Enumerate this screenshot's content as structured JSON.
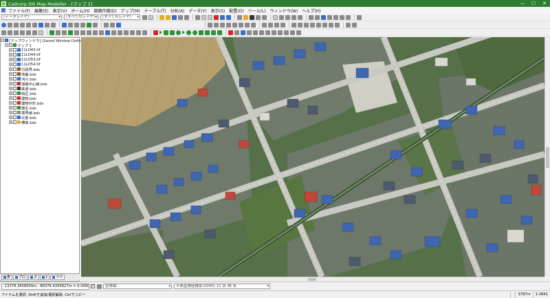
{
  "window": {
    "title": "Cadcorp SIS Map Modeller - [マップ 1]",
    "minimize_glyph": "—",
    "maximize_glyph": "☐",
    "close_glyph": "✕"
  },
  "menu": {
    "items": [
      "ファイル(F)",
      "編集(E)",
      "表示(V)",
      "ホーム(H)",
      "図面作図(D)",
      "アップ(M)",
      "テーブル(T)",
      "分析(A)",
      "データ(Y)",
      "表示(S)",
      "配置(O)",
      "ツール(L)",
      "ウィンドウ(W)",
      "ヘルプ(H)"
    ]
  },
  "toolbar1": {
    "combo_scale": "(データレイヤ)",
    "combo_layer": "(すべてのレイヤ)",
    "combo_style": "(すべてのレイヤ)"
  },
  "tree": {
    "root_label": "[マップウィンドウ] (Saved Window Definitions)",
    "map_label": "マップ 1",
    "items": [
      {
        "label": "11LD43.tif",
        "color": "#3a6fc4"
      },
      {
        "label": "11LD44.tif",
        "color": "#3a6fc4"
      },
      {
        "label": "11LD53.tif",
        "color": "#3a6fc4"
      },
      {
        "label": "11LD54.tif",
        "color": "#3a6fc4"
      },
      {
        "label": "行政界.bds",
        "color": "#8a5a2b"
      },
      {
        "label": "地番.bds",
        "color": "#8a5a2b"
      },
      {
        "label": "河川.bds",
        "color": "#3a6fc4"
      },
      {
        "label": "道路中心線.bds",
        "color": "#cc2b2b"
      },
      {
        "label": "鉄道.bds",
        "color": "#333333"
      },
      {
        "label": "街区.bds",
        "color": "#2f8f3a"
      },
      {
        "label": "建物.bds",
        "color": "#cc2b2b"
      },
      {
        "label": "建物外形.bds",
        "color": "#cc2b2b"
      },
      {
        "label": "植生.bds",
        "color": "#2f8f3a"
      },
      {
        "label": "境界線.bds",
        "color": "#8a8a8a"
      },
      {
        "label": "水部.bds",
        "color": "#3a6fc4"
      },
      {
        "label": "標高.bds",
        "color": "#e0b020"
      }
    ]
  },
  "panel_tabs": [
    "表",
    "プロ",
    "ス",
    "2",
    "ツイ"
  ],
  "coordbar": {
    "coordinates": "-13378.3658000m, -86376.4355827m = 0.0000000m",
    "unit_combo": "全体図",
    "crs_combo": "平面直角座標系(2000) 12 系 Ⅻ 系"
  },
  "status": {
    "message": "アイテムを選択, Shiftで追加/選択解除, Ctrlでコピー",
    "scale": "1:3841",
    "cell1": "",
    "cell2": "3787m"
  }
}
